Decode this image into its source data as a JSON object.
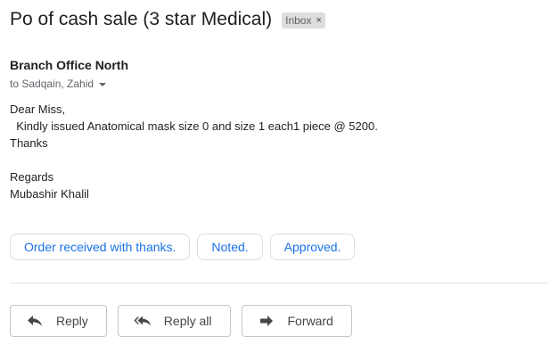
{
  "email": {
    "subject": "Po of cash sale (3 star Medical)",
    "label": "Inbox",
    "label_remove": "×",
    "sender": "Branch Office North",
    "recipients": "to Sadqain, Zahid",
    "body_lines": [
      "Dear Miss,",
      "  Kindly issued Anatomical mask size 0 and size 1 each1 piece @ 5200.",
      "Thanks",
      "",
      "Regards",
      "Mubashir Khalil"
    ]
  },
  "smart_replies": [
    "Order received with thanks.",
    "Noted.",
    "Approved."
  ],
  "actions": {
    "reply": "Reply",
    "reply_all": "Reply all",
    "forward": "Forward"
  },
  "icons": {
    "reply": "reply-arrow-icon",
    "reply_all": "reply-all-arrow-icon",
    "forward": "forward-arrow-icon",
    "expand": "caret-down-icon"
  },
  "colors": {
    "link_blue": "#1a73e8",
    "label_bg": "#dddddd",
    "muted_text": "#5f6368"
  }
}
